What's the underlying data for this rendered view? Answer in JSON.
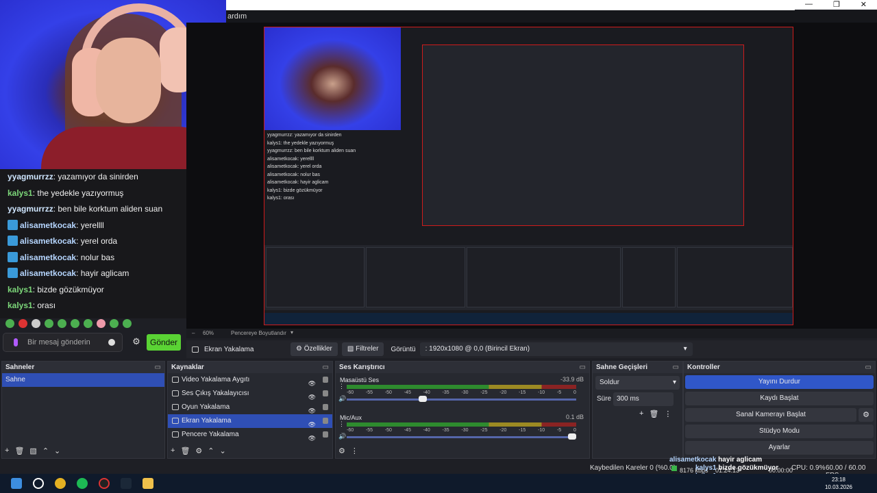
{
  "menubar": {
    "text": "ardım"
  },
  "window_controls": {
    "minimize": "—",
    "restore": "❐",
    "close": "✕"
  },
  "chat": {
    "messages": [
      {
        "user": "yyagmurrzz",
        "text": "yazamıyor da sinirden",
        "badge": false
      },
      {
        "user": "kalys1",
        "text": "the yedekle yazıyormuş",
        "badge": false
      },
      {
        "user": "yyagmurrzz",
        "text": "ben bile korktum aliden suan",
        "badge": false
      },
      {
        "user": "alisametkocak",
        "text": "yerellll",
        "badge": true
      },
      {
        "user": "alisametkocak",
        "text": "yerel orda",
        "badge": true
      },
      {
        "user": "alisametkocak",
        "text": "nolur bas",
        "badge": true
      },
      {
        "user": "alisametkocak",
        "text": "hayir aglicam",
        "badge": true
      },
      {
        "user": "kalys1",
        "text": "bizde gözükmüyor",
        "badge": false
      },
      {
        "user": "kalys1",
        "text": "orası",
        "badge": false
      }
    ],
    "input_placeholder": "Bir mesaj gönderin",
    "send_label": "Gönder"
  },
  "zoom": {
    "percent": "60%",
    "fit_label": "Pencereye Boyutlandır"
  },
  "source_toolbar": {
    "source_name": "Ekran Yakalama",
    "properties": "Özellikler",
    "filters": "Filtreler",
    "display_label": "Görüntü",
    "display_value": ": 1920x1080 @ 0,0 (Birincil Ekran)"
  },
  "scenes": {
    "title": "Sahneler",
    "items": [
      "Sahne"
    ]
  },
  "sources": {
    "title": "Kaynaklar",
    "items": [
      "Video Yakalama Aygıtı",
      "Ses Çıkış Yakalayıcısı",
      "Oyun Yakalama",
      "Ekran Yakalama",
      "Pencere Yakalama"
    ],
    "selected": 3
  },
  "mixer": {
    "title": "Ses Karıştırıcı",
    "channels": [
      {
        "name": "Masaüstü Ses",
        "db": "-33.9 dB",
        "level": 0.35
      },
      {
        "name": "Mic/Aux",
        "db": "0.1 dB",
        "level": 1.0
      }
    ],
    "scale": [
      "-60",
      "-55",
      "-50",
      "-45",
      "-40",
      "-35",
      "-30",
      "-25",
      "-20",
      "-15",
      "-10",
      "-5",
      "0"
    ]
  },
  "transitions": {
    "title": "Sahne Geçişleri",
    "type": "Soldur",
    "duration_label": "Süre",
    "duration": "300 ms"
  },
  "controls": {
    "title": "Kontroller",
    "buttons": [
      "Yayını Durdur",
      "Kaydı Başlat",
      "Sanal Kamerayı Başlat",
      "Stüdyo Modu",
      "Ayarlar"
    ]
  },
  "status": {
    "dropped": "Kaybedilen Kareler 0 (%0.0)",
    "bitrate": "8176 kbps",
    "time": "01:24:13",
    "rec_time": "00:00:00",
    "cpu": "CPU: 0.9%",
    "fps": "60.00 / 60.00 FPS"
  },
  "overlay": [
    {
      "user": "alisametkocak",
      "text": "hayir aglicam"
    },
    {
      "user": "kalys1",
      "text": "bizde gözükmüyor"
    },
    {
      "user": "kalys1",
      "text": "orası"
    }
  ],
  "clock": {
    "time": "23:18",
    "date": "10.03.2026"
  },
  "colors": {
    "accent": "#3057c8",
    "send": "#5ad334",
    "preview_border": "#d01b1b"
  }
}
